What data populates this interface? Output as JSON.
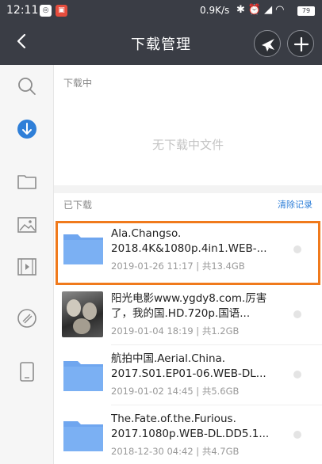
{
  "status": {
    "time": "12:11",
    "speed": "0.9K/s",
    "battery": "79"
  },
  "header": {
    "title": "下载管理"
  },
  "downloading": {
    "label": "下载中",
    "empty_text": "无下载中文件"
  },
  "downloaded": {
    "label": "已下载",
    "clear_label": "清除记录",
    "items": [
      {
        "name": "Ala.Changso.\n2018.4K&1080p.4in1.WEB-...",
        "meta": "2019-01-26 11:17 | 共13.4GB",
        "thumb": "folder"
      },
      {
        "name": "阳光电影www.ygdy8.com.厉害了，我的国.HD.720p.国语...",
        "meta": "2019-01-04 18:19 | 共1.2GB",
        "thumb": "poster"
      },
      {
        "name": "航拍中国.Aerial.China.\n2017.S01.EP01-06.WEB-DL...",
        "meta": "2019-01-02 14:45 | 共5.6GB",
        "thumb": "folder"
      },
      {
        "name": "The.Fate.of.the.Furious.\n2017.1080p.WEB-DL.DD5.1...",
        "meta": "2018-12-30 04:42 | 共4.7GB",
        "thumb": "folder"
      }
    ]
  },
  "colors": {
    "header_bg": "#3a3d45",
    "accent": "#2f7fd8",
    "folder": "#6fa6ef",
    "highlight": "#f07a1c"
  },
  "sidebar_icons": [
    "search-icon",
    "download-icon",
    "folder-icon",
    "image-icon",
    "video-icon",
    "music-icon",
    "tablet-icon"
  ]
}
